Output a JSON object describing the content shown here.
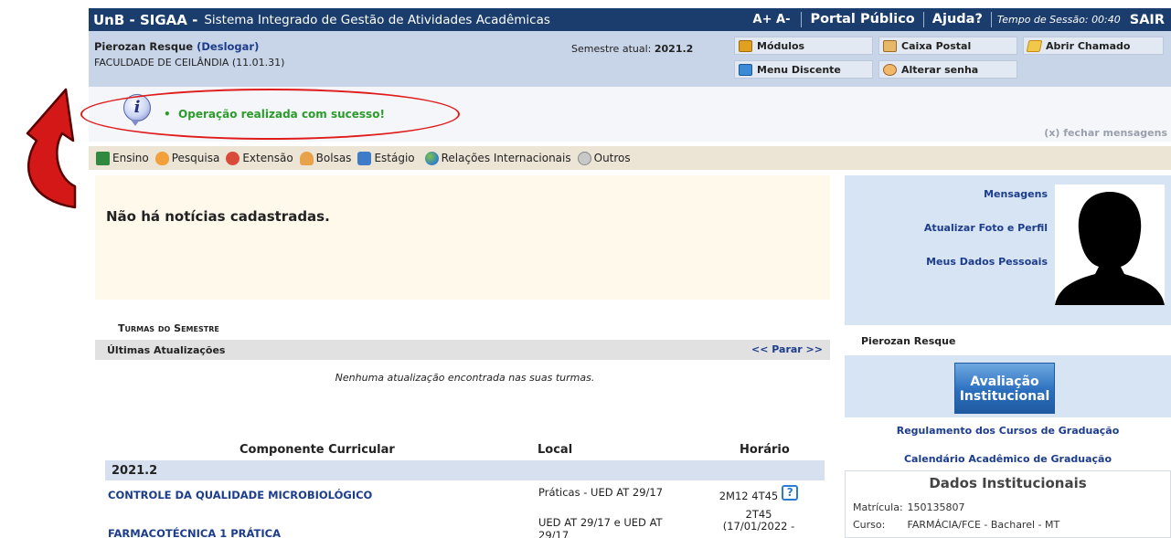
{
  "header": {
    "brand": "UnB - SIGAA -",
    "subtitle": "Sistema Integrado de Gestão de Atividades Acadêmicas",
    "font_size": "A+ A-",
    "portal": "Portal Público",
    "ajuda": "Ajuda?",
    "session_label": "Tempo de Sessão:",
    "session_time": "00:40",
    "sair": "SAIR"
  },
  "user": {
    "name": "Pierozan Resque",
    "logout": "(Deslogar)",
    "faculty": "FACULDADE DE CEILÂNDIA (11.01.31)",
    "semester_label": "Semestre atual:",
    "semester_value": "2021.2"
  },
  "quick_links": {
    "modulos": "Módulos",
    "caixa_postal": "Caixa Postal",
    "abrir_chamado": "Abrir Chamado",
    "menu_discente": "Menu Discente",
    "alterar_senha": "Alterar senha"
  },
  "message": {
    "text": "Operação realizada com sucesso!",
    "close": "(x) fechar mensagens"
  },
  "menu": [
    "Ensino",
    "Pesquisa",
    "Extensão",
    "Bolsas",
    "Estágio",
    "Relações Internacionais",
    "Outros"
  ],
  "news": {
    "empty": "Não há notícias cadastradas."
  },
  "turmas": {
    "title": "Turmas do Semestre",
    "updates_label": "Últimas Atualizações",
    "pause": "<< Parar >>",
    "no_updates": "Nenhuma atualização encontrada nas suas turmas.",
    "col_component": "Componente Curricular",
    "col_local": "Local",
    "col_horario": "Horário",
    "semester": "2021.2",
    "rows": [
      {
        "name": "CONTROLE DA QUALIDADE MICROBIOLÓGICO",
        "local": "Práticas - UED AT 29/17",
        "horario": "2M12 4T45"
      },
      {
        "name": "FARMACOTÉCNICA 1 PRÁTICA",
        "local_1": "UED AT 29/17 e UED AT",
        "local_2": "29/17",
        "horario_1": "2T45",
        "horario_2": "(17/01/2022 -"
      }
    ]
  },
  "side": {
    "mensagens": "Mensagens",
    "atualizar_foto": "Atualizar Foto e Perfil",
    "meus_dados": "Meus Dados Pessoais",
    "user_name": "Pierozan Resque",
    "avaliacao_1": "Avaliação",
    "avaliacao_2": "Institucional",
    "regulamento": "Regulamento dos Cursos de Graduação",
    "calendario": "Calendário Acadêmico de Graduação",
    "dados_title": "Dados Institucionais",
    "matricula_label": "Matrícula:",
    "matricula_value": "150135807",
    "curso_label": "Curso:",
    "curso_value": "FARMÁCIA/FCE - Bacharel - MT"
  },
  "colors": {
    "header": "#1a3d6d",
    "userbar": "#c8d5e8",
    "success": "#2c9b2c",
    "highlight": "#e01b1b",
    "link": "#1c3c8c"
  }
}
